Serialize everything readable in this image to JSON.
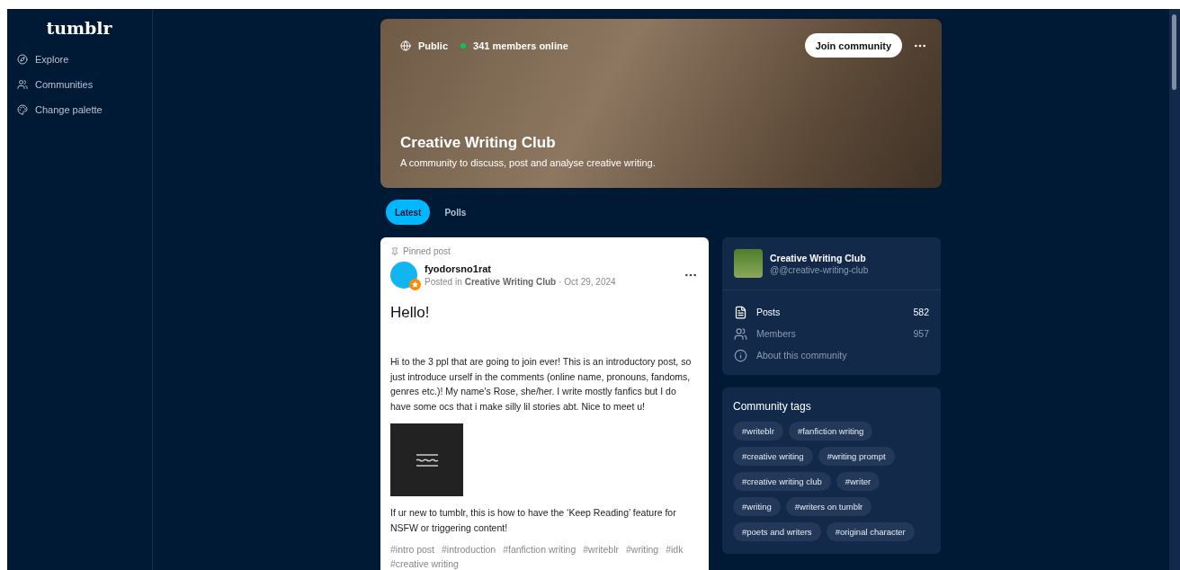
{
  "sidebar": {
    "logo": "tumblr",
    "items": [
      {
        "label": "Explore"
      },
      {
        "label": "Communities"
      },
      {
        "label": "Change palette"
      }
    ]
  },
  "banner": {
    "visibility": "Public",
    "online": "341 members online",
    "title": "Creative Writing Club",
    "description": "A community to discuss, post and analyse creative writing.",
    "join_button": "Join community"
  },
  "tabs": [
    {
      "label": "Latest",
      "selected": true
    },
    {
      "label": "Polls",
      "selected": false
    }
  ],
  "post": {
    "pinned_label": "Pinned post",
    "author": "fyodorsno1rat",
    "posted_in_prefix": "Posted in",
    "community": "Creative Writing Club",
    "date": "· Oct 29, 2024",
    "title": "Hello!",
    "body": "Hi to the 3 ppl that are going to join ever! This is an introductory post, so just introduce urself in the comments (online name, pronouns, fandoms, genres etc.)! My name's Rose, she/her. I write mostly fanfics but I do have some ocs that i make silly lil stories abt. Nice to meet u!",
    "body2": "If ur new to tumblr, this is how to have the ‘Keep Reading’ feature for NSFW or triggering content!",
    "tags": [
      "#intro post",
      "#introduction",
      "#fanfiction writing",
      "#writeblr",
      "#writing",
      "#idk",
      "#creative writing"
    ]
  },
  "community_card": {
    "name": "Creative Writing Club",
    "handle": "@@creative-writing-club",
    "stats": [
      {
        "label": "Posts",
        "value": "582",
        "selected": true
      },
      {
        "label": "Members",
        "value": "957",
        "selected": false
      }
    ],
    "about": "About this community"
  },
  "community_tags": {
    "title": "Community tags",
    "tags": [
      "#writeblr",
      "#fanfiction writing",
      "#creative writing",
      "#writing prompt",
      "#creative writing club",
      "#writer",
      "#writing",
      "#writers on tumblr",
      "#poets and writers",
      "#original character"
    ]
  }
}
